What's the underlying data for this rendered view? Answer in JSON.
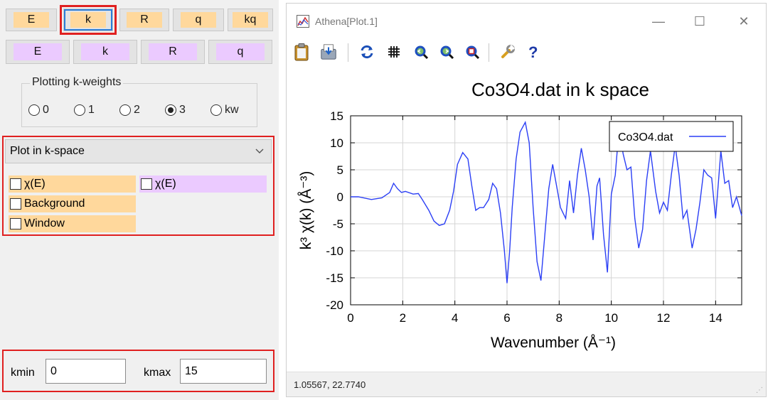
{
  "left_panel": {
    "row1": [
      {
        "label": "E"
      },
      {
        "label": "k"
      },
      {
        "label": "R"
      },
      {
        "label": "q"
      },
      {
        "label": "kq"
      }
    ],
    "row2": [
      {
        "label": "E"
      },
      {
        "label": "k"
      },
      {
        "label": "R"
      },
      {
        "label": "q"
      }
    ],
    "kweights": {
      "title": "Plotting k-weights",
      "options": [
        "0",
        "1",
        "2",
        "3",
        "kw"
      ],
      "selected": "3"
    },
    "plot_select": {
      "value": "Plot in k-space"
    },
    "checks": {
      "chi_e_orange": "χ(E)",
      "chi_e_violet": "χ(E)",
      "background": "Background",
      "window": "Window"
    },
    "krange": {
      "kmin_label": "kmin",
      "kmin_value": "0",
      "kmax_label": "kmax",
      "kmax_value": "15"
    },
    "colors": {
      "orange": "#ffd89c",
      "violet": "#ebcaff",
      "highlight": "#e02020"
    }
  },
  "plot_window": {
    "title": "Athena[Plot.1]",
    "controls": {
      "minimize": "—",
      "maximize": "☐",
      "close": "✕"
    },
    "toolbar_icons": [
      "clipboard-icon",
      "save-icon",
      "refresh-icon",
      "grid-icon",
      "zoom-in-icon",
      "zoom-out-icon",
      "zoom-reset-icon",
      "configure-icon",
      "help-icon"
    ],
    "status": "1.05567,  22.7740"
  },
  "chart_data": {
    "type": "line",
    "title": "Co3O4.dat in k space",
    "xlabel": "Wavenumber   (Å⁻¹)",
    "ylabel": "k³ χ(k)   (Å⁻³)",
    "xlim": [
      0,
      15
    ],
    "ylim": [
      -20,
      15
    ],
    "xticks": [
      0,
      2,
      4,
      6,
      8,
      10,
      12,
      14
    ],
    "yticks": [
      15,
      10,
      5,
      0,
      -5,
      -10,
      -15,
      -20
    ],
    "grid": true,
    "legend": "top-right",
    "series": [
      {
        "name": "Co3O4.dat",
        "color": "#2b3ff5",
        "x": [
          0,
          0.3,
          0.8,
          1.2,
          1.5,
          1.65,
          1.8,
          1.95,
          2.1,
          2.4,
          2.6,
          2.75,
          3.0,
          3.2,
          3.4,
          3.6,
          3.8,
          3.95,
          4.1,
          4.3,
          4.5,
          4.65,
          4.8,
          4.95,
          5.1,
          5.3,
          5.45,
          5.6,
          5.75,
          5.9,
          6.0,
          6.1,
          6.2,
          6.35,
          6.5,
          6.7,
          6.85,
          7.0,
          7.15,
          7.3,
          7.45,
          7.6,
          7.75,
          7.9,
          8.05,
          8.15,
          8.25,
          8.4,
          8.55,
          8.7,
          8.85,
          9.0,
          9.15,
          9.3,
          9.45,
          9.55,
          9.7,
          9.85,
          10.0,
          10.15,
          10.3,
          10.45,
          10.6,
          10.75,
          10.9,
          11.05,
          11.2,
          11.35,
          11.5,
          11.7,
          11.85,
          12.0,
          12.15,
          12.3,
          12.45,
          12.6,
          12.75,
          12.9,
          13.1,
          13.25,
          13.4,
          13.55,
          13.7,
          13.85,
          14.0,
          14.2,
          14.35,
          14.5,
          14.65,
          14.8,
          15.0
        ],
        "y": [
          0,
          0,
          -0.5,
          -0.2,
          0.8,
          2.5,
          1.5,
          0.8,
          1,
          0.5,
          0.6,
          -0.5,
          -2.5,
          -4.5,
          -5.3,
          -5,
          -2.5,
          1,
          6,
          8.2,
          7,
          2,
          -2.5,
          -2,
          -2,
          -0.5,
          2.5,
          1.5,
          -3,
          -10,
          -16,
          -10,
          -2,
          7,
          12,
          13.8,
          10,
          -2,
          -12,
          -15.5,
          -7,
          1.5,
          6,
          2,
          -2,
          -3,
          -4,
          3,
          -3,
          4,
          9,
          5,
          0,
          -8,
          2,
          3.5,
          -7,
          -14,
          0.5,
          4,
          13,
          8,
          5,
          5.5,
          -4,
          -9.5,
          -6,
          3,
          8.5,
          1,
          -3,
          -1,
          -2.5,
          4,
          9.5,
          4,
          -4,
          -2.5,
          -9.5,
          -6,
          -1,
          5,
          4,
          3.5,
          -4,
          8.5,
          2.5,
          3,
          -2,
          0,
          -3.5
        ]
      }
    ]
  }
}
